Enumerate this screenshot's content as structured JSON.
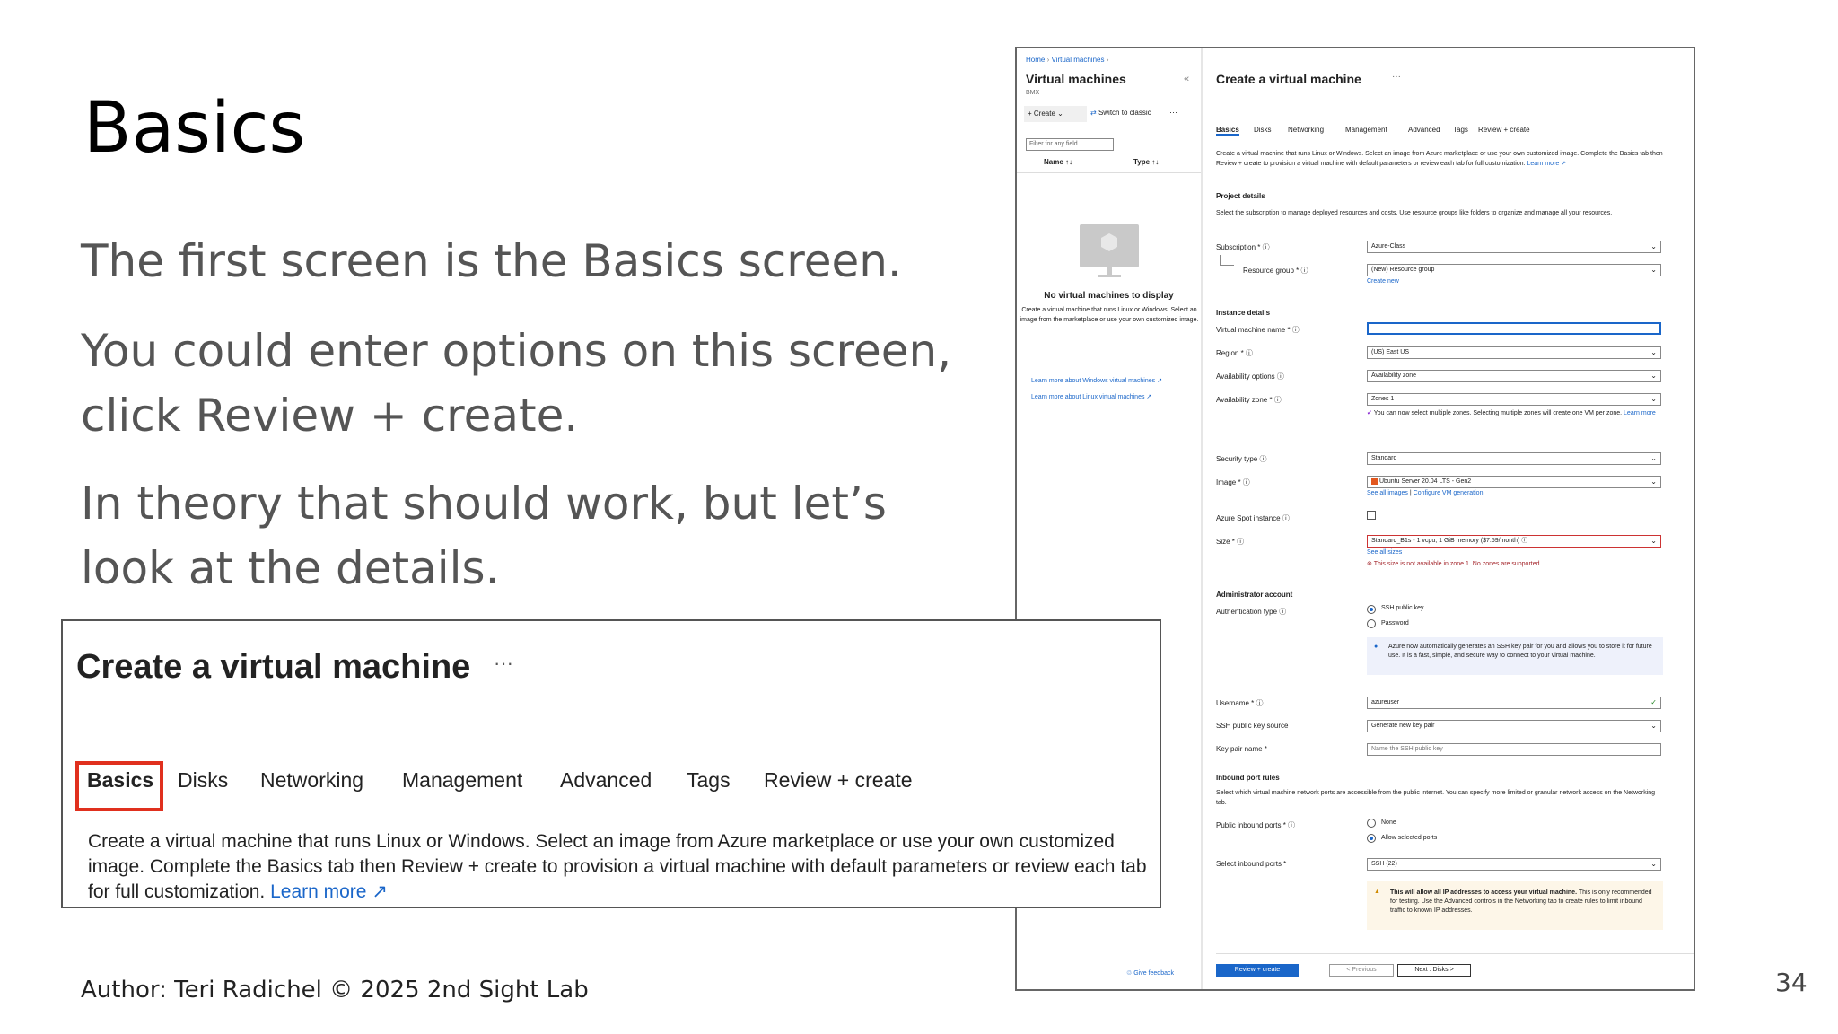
{
  "slide": {
    "title": "Basics",
    "paragraphs": [
      "The first screen is the Basics screen.",
      "You could enter options on this screen, click Review + create.",
      "In theory that should work, but let’s look at the details."
    ],
    "footer": "Author: Teri Radichel © 2025 2nd Sight Lab",
    "page_number": "34"
  },
  "zoom": {
    "title": "Create a virtual machine",
    "dots": "···",
    "tabs": [
      "Basics",
      "Disks",
      "Networking",
      "Management",
      "Advanced",
      "Tags",
      "Review + create"
    ],
    "description": "Create a virtual machine that runs Linux or Windows. Select an image from Azure marketplace or use your own customized image. Complete the Basics tab then Review + create to provision a virtual machine with default parameters or review each tab for full customization.",
    "learn_more": "Learn more",
    "highlight_color": "#e0301e"
  },
  "azure": {
    "breadcrumb": [
      "Home",
      "Virtual machines"
    ],
    "left": {
      "title": "Virtual machines",
      "subtitle": "BMX",
      "collapse": "«",
      "create_label": "Create",
      "switch_label": "Switch to classic",
      "more": "···",
      "filter_placeholder": "Filter for any field...",
      "col_name": "Name ↑↓",
      "col_type": "Type ↑↓",
      "empty_title": "No virtual machines to display",
      "empty_desc": "Create a virtual machine that runs Linux or Windows. Select an image from the marketplace or use your own customized image.",
      "link_windows": "Learn more about Windows virtual machines",
      "link_linux": "Learn more about Linux virtual machines",
      "feedback": "Give feedback"
    },
    "main": {
      "title": "Create a virtual machine",
      "dots": "···",
      "tabs": [
        "Basics",
        "Disks",
        "Networking",
        "Management",
        "Advanced",
        "Tags",
        "Review + create"
      ],
      "intro": "Create a virtual machine that runs Linux or Windows. Select an image from Azure marketplace or use your own customized image. Complete the Basics tab then Review + create to provision a virtual machine with default parameters or review each tab for full customization.",
      "learn_more": "Learn more",
      "project_details": "Project details",
      "project_desc": "Select the subscription to manage deployed resources and costs. Use resource groups like folders to organize and manage all your resources.",
      "subscription_label": "Subscription *",
      "subscription_value": "Azure-Class",
      "rg_label": "Resource group *",
      "rg_value": "(New) Resource group",
      "create_new": "Create new",
      "instance_details": "Instance details",
      "vmname_label": "Virtual machine name *",
      "region_label": "Region *",
      "region_value": "(US) East US",
      "avail_label": "Availability options",
      "avail_value": "Availability zone",
      "zone_label": "Availability zone *",
      "zone_value": "Zones 1",
      "zone_note": "You can now select multiple zones. Selecting multiple zones will create one VM per zone.",
      "zone_learn": "Learn more",
      "security_label": "Security type",
      "security_value": "Standard",
      "image_label": "Image *",
      "image_value": "Ubuntu Server 20.04 LTS - Gen2",
      "see_all_images": "See all images",
      "configure_vm": "Configure VM generation",
      "spot_label": "Azure Spot instance",
      "size_label": "Size *",
      "size_value": "Standard_B1s - 1 vcpu, 1 GiB memory ($7.59/month)",
      "see_all_sizes": "See all sizes",
      "size_error": "This size is not available in zone 1. No zones are supported",
      "admin_account": "Administrator account",
      "auth_label": "Authentication type",
      "auth_ssh": "SSH public key",
      "auth_pwd": "Password",
      "ssh_info": "Azure now automatically generates an SSH key pair for you and allows you to store it for future use. It is a fast, simple, and secure way to connect to your virtual machine.",
      "username_label": "Username *",
      "username_value": "azureuser",
      "sshsrc_label": "SSH public key source",
      "sshsrc_value": "Generate new key pair",
      "keypair_label": "Key pair name *",
      "keypair_placeholder": "Name the SSH public key",
      "inbound_rules": "Inbound port rules",
      "inbound_desc": "Select which virtual machine network ports are accessible from the public internet. You can specify more limited or granular network access on the Networking tab.",
      "public_ports_label": "Public inbound ports *",
      "ports_none": "None",
      "ports_allow": "Allow selected ports",
      "select_ports_label": "Select inbound ports *",
      "select_ports_value": "SSH (22)",
      "warn_bold": "This will allow all IP addresses to access your virtual machine.",
      "warn_text": "This is only recommended for testing. Use the Advanced controls in the Networking tab to create rules to limit inbound traffic to known IP addresses.",
      "btn_review": "Review + create",
      "btn_prev": "< Previous",
      "btn_next": "Next : Disks >"
    }
  }
}
